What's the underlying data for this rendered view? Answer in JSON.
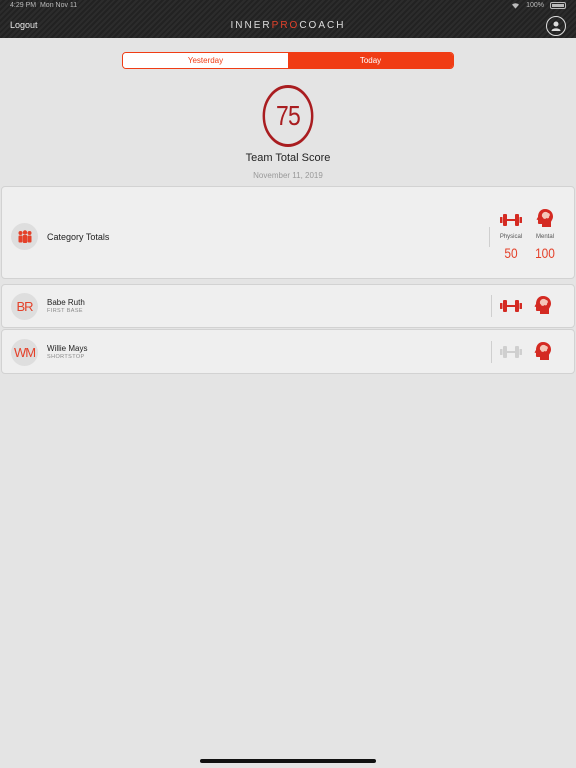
{
  "status": {
    "time": "4:29 PM",
    "day": "Mon Nov 11",
    "battery": "100%"
  },
  "nav": {
    "logout": "Logout",
    "logo_prefix": "INNER",
    "logo_accent": "PRO",
    "logo_suffix": "COACH",
    "profile_icon": "user-icon"
  },
  "tabs": {
    "yesterday": "Yesterday",
    "today": "Today",
    "selected": "Today"
  },
  "score": {
    "value": "75",
    "title": "Team Total Score",
    "date": "November 11, 2019"
  },
  "totals": {
    "label": "Category Totals",
    "physical_label": "Physical",
    "physical_value": "50",
    "mental_label": "Mental",
    "mental_value": "100"
  },
  "players": [
    {
      "initials": "BR",
      "name": "Babe Ruth",
      "position": "FIRST BASE",
      "physical_active": true,
      "mental_active": true
    },
    {
      "initials": "WM",
      "name": "Willie Mays",
      "position": "SHORTSTOP",
      "physical_active": false,
      "mental_active": true
    }
  ],
  "colors": {
    "accent": "#f03c14",
    "score_ring": "#a91d20",
    "icon_red": "#d42a22",
    "icon_inactive": "#cfcfcf"
  }
}
